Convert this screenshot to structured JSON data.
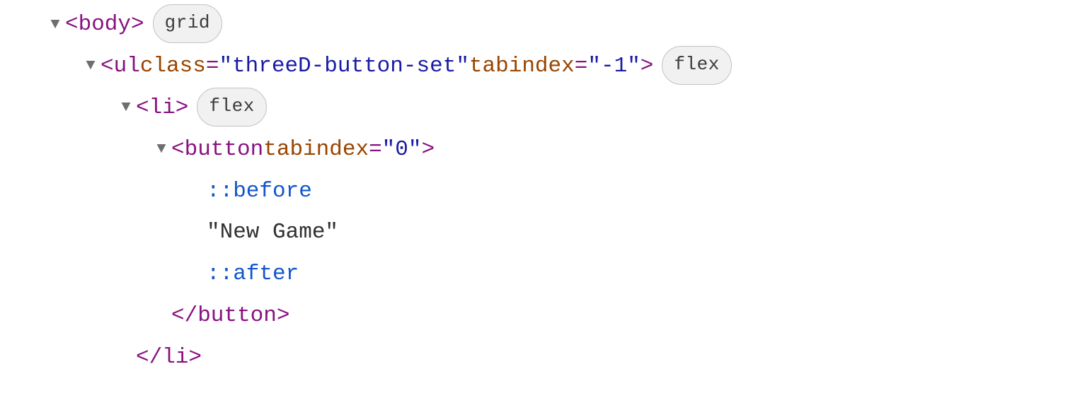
{
  "tree": {
    "row0": {
      "tag_open": "<body>",
      "badge": "grid"
    },
    "row1": {
      "prefix": "<ul",
      "attr1_name": " class",
      "eq1": "=",
      "q1a": "\"",
      "attr1_val": "threeD-button-set",
      "q1b": "\"",
      "attr2_name": " tabindex",
      "eq2": "=",
      "q2a": "\"",
      "attr2_val": "-1",
      "q2b": "\"",
      "suffix": ">",
      "badge": "flex"
    },
    "row2": {
      "tag_open": "<li>",
      "badge": "flex"
    },
    "row3": {
      "prefix": "<button",
      "attr1_name": " tabindex",
      "eq1": "=",
      "q1a": "\"",
      "attr1_val": "0",
      "q1b": "\"",
      "suffix": ">"
    },
    "row4": {
      "pseudo": "::before"
    },
    "row5": {
      "text": "\"New Game\""
    },
    "row6": {
      "pseudo": "::after"
    },
    "row7": {
      "tag_close": "</button>"
    },
    "row8": {
      "tag_close": "</li>"
    }
  }
}
